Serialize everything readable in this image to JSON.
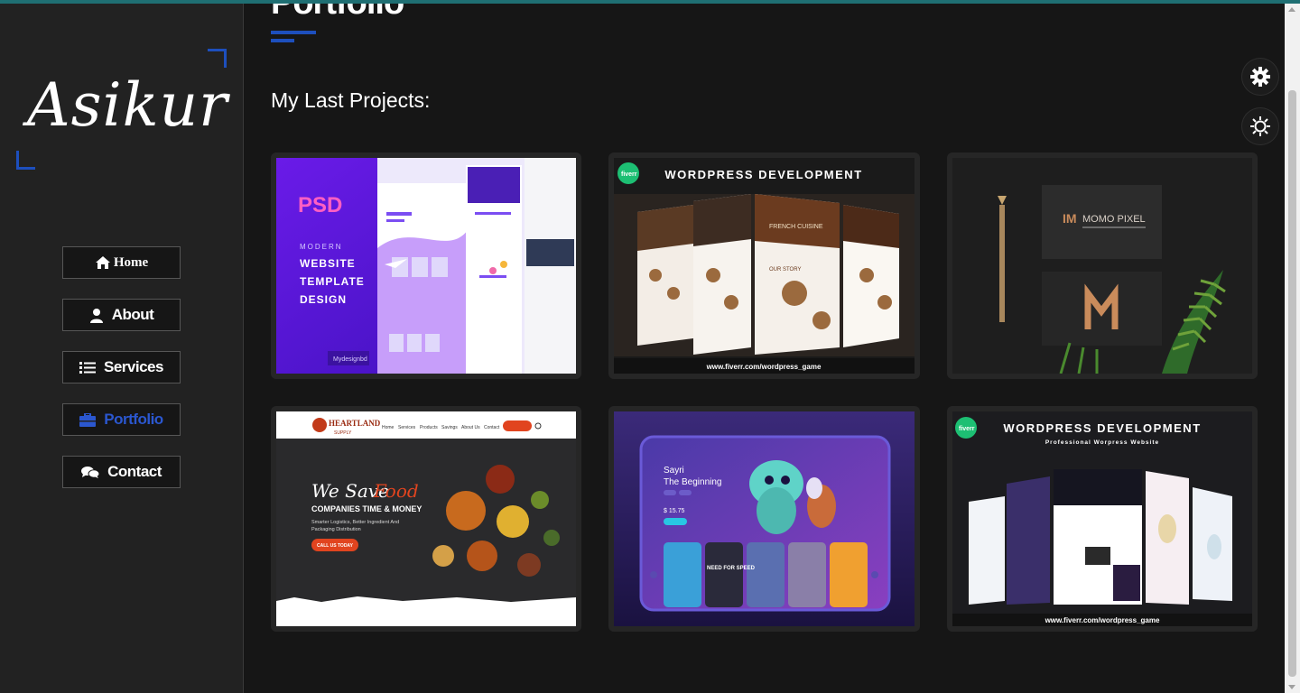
{
  "logo": {
    "text": "Asikur"
  },
  "nav": [
    {
      "label": "Home",
      "icon": "home-icon"
    },
    {
      "label": "About",
      "icon": "user-icon"
    },
    {
      "label": "Services",
      "icon": "list-icon"
    },
    {
      "label": "Portfolio",
      "icon": "briefcase-icon",
      "active": true
    },
    {
      "label": "Contact",
      "icon": "chat-icon"
    }
  ],
  "main": {
    "title": "Portfolio",
    "subtitle": "My Last Projects:"
  },
  "projects": [
    {
      "name": "psd-template",
      "lines": [
        "PSD",
        "MODERN",
        "WEBSITE",
        "TEMPLATE",
        "DESIGN",
        "Mydesignbd"
      ]
    },
    {
      "name": "wordpress-1",
      "lines": [
        "WORDPRESS DEVELOPMENT",
        "www.fiverr.com/wordpress_game",
        "fiverr",
        "FRENCH CUISINE",
        "OUR STORY"
      ]
    },
    {
      "name": "momo-pixel",
      "lines": [
        "MOMO PIXEL"
      ]
    },
    {
      "name": "heartland",
      "lines": [
        "HEARTLAND",
        "SUPPLY",
        "We Save",
        "Food",
        "COMPANIES TIME & MONEY",
        "Smarter Logistics, Better Ingredient And",
        "Packaging Distribution",
        "CALL US TODAY",
        "Home",
        "Services",
        "Products",
        "Savings",
        "About Us",
        "Contact"
      ]
    },
    {
      "name": "game-ui",
      "lines": [
        "Sayri",
        "The Beginning",
        "$ 15.75",
        "NEED FOR SPEED"
      ]
    },
    {
      "name": "wordpress-2",
      "lines": [
        "WORDPRESS DEVELOPMENT",
        "Professional Worpress Website",
        "www.fiverr.com/wordpress_game",
        "fiverr"
      ]
    }
  ],
  "colors": {
    "accent": "#1d4fbd",
    "bg": "#161616",
    "sidebar": "#222222",
    "active": "#2b57cf"
  },
  "controls": {
    "settings": "gear-icon",
    "theme": "sun-icon"
  }
}
